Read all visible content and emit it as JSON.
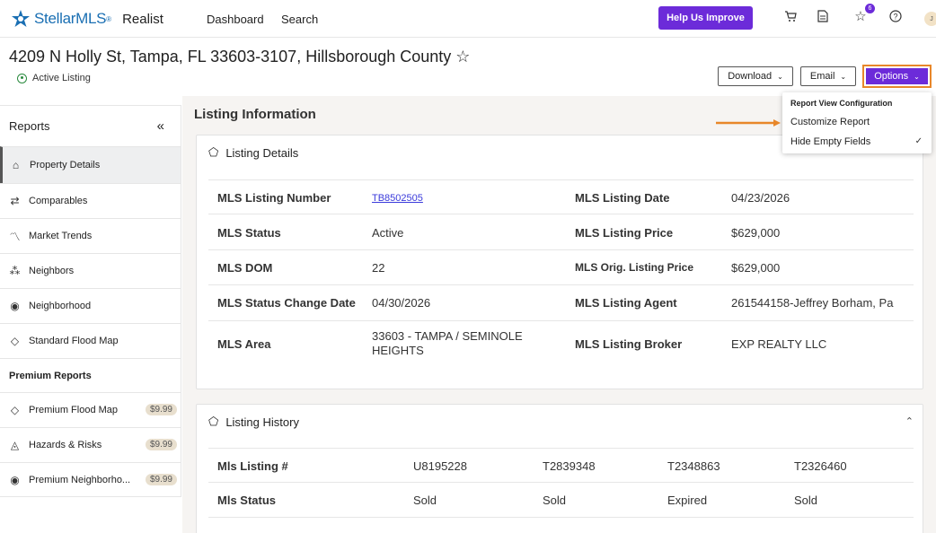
{
  "nav": {
    "logo_text": "StellarMLS",
    "logo_reg": "®",
    "app_name": "Realist",
    "links": [
      "Dashboard",
      "Search"
    ],
    "help_button": "Help Us Improve",
    "notification_count": "6",
    "avatar_initial": "J"
  },
  "header": {
    "address": "4209 N Holly St, Tampa, FL 33603-3107, Hillsborough County ☆",
    "status": "Active Listing",
    "download_label": "Download",
    "email_label": "Email",
    "options_label": "Options"
  },
  "options_menu": {
    "header": "Report View Configuration",
    "items": [
      "Customize Report",
      "Hide Empty Fields"
    ],
    "checked": "✓"
  },
  "sidebar": {
    "title": "Reports",
    "collapse": "«",
    "items": [
      {
        "label": "Property Details",
        "icon": "home-icon"
      },
      {
        "label": "Comparables",
        "icon": "compare-icon"
      },
      {
        "label": "Market Trends",
        "icon": "trend-icon"
      },
      {
        "label": "Neighbors",
        "icon": "people-icon"
      },
      {
        "label": "Neighborhood",
        "icon": "pin-icon"
      },
      {
        "label": "Standard Flood Map",
        "icon": "drop-icon"
      }
    ],
    "premium_title": "Premium Reports",
    "premium_items": [
      {
        "label": "Premium Flood Map",
        "price": "$9.99"
      },
      {
        "label": "Hazards & Risks",
        "price": "$9.99"
      },
      {
        "label": "Premium Neighborho...",
        "price": "$9.99"
      }
    ]
  },
  "main": {
    "title": "Listing Information",
    "details_title": "Listing Details",
    "details_rows": [
      {
        "l1": "MLS Listing Number",
        "v1": "TB8502505",
        "l2": "MLS Listing Date",
        "v2": "04/23/2026"
      },
      {
        "l1": "MLS Status",
        "v1": "Active",
        "l2": "MLS Listing Price",
        "v2": "$629,000"
      },
      {
        "l1": "MLS DOM",
        "v1": "22",
        "l2": "MLS Orig. Listing Price",
        "v2": "$629,000"
      },
      {
        "l1": "MLS Status Change Date",
        "v1": "04/30/2026",
        "l2": "MLS Listing Agent",
        "v2": "261544158-Jeffrey Borham, Pa"
      },
      {
        "l1": "MLS Area",
        "v1a": "33603 - TAMPA / SEMINOLE",
        "v1b": "HEIGHTS",
        "l2": "MLS Listing Broker",
        "v2": "EXP REALTY LLC"
      }
    ],
    "history_title": "Listing History",
    "history_rows": [
      {
        "label": "Mls Listing #",
        "values": [
          "U8195228",
          "T2839348",
          "T2348863",
          "T2326460"
        ]
      },
      {
        "label": "Mls Status",
        "values": [
          "Sold",
          "Sold",
          "Expired",
          "Sold"
        ]
      }
    ]
  },
  "colors": {
    "accent": "#6c2bd9",
    "highlight": "#e8872a",
    "link": "#3b3bdb"
  }
}
